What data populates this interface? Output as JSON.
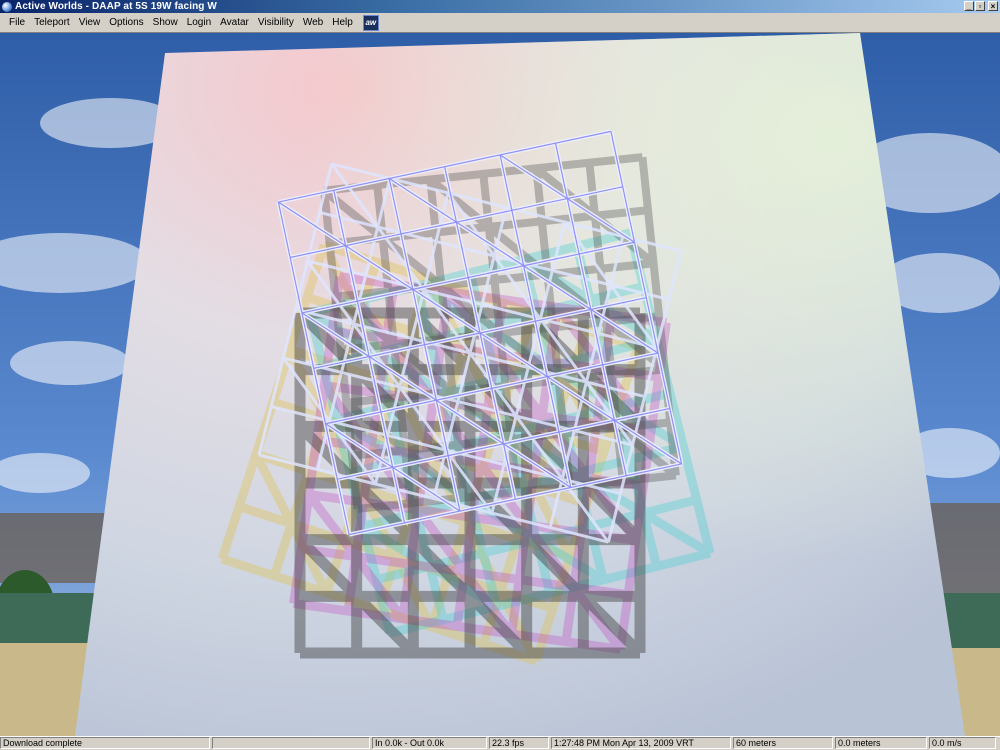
{
  "window": {
    "title": "Active Worlds - DAAP at 5S 19W facing W",
    "buttons": {
      "minimize": "_",
      "maximize": "▫",
      "close": "×"
    }
  },
  "menu": {
    "items": [
      "File",
      "Teleport",
      "View",
      "Options",
      "Show",
      "Login",
      "Avatar",
      "Visibility",
      "Web",
      "Help"
    ],
    "logo_text": "aw"
  },
  "scene": {
    "colors": {
      "sky": "#3f6fb8",
      "panel": "#d9d0dc",
      "grid": "#e8e8f4",
      "grid_edge": "#6a6ae8",
      "ground": "#3d6b57"
    }
  },
  "status": {
    "message": "Download complete",
    "traffic": "In  0.0k - Out  0.0k",
    "fps": "22.3 fps",
    "datetime": "1:27:48 PM Mon Apr 13, 2009 VRT",
    "visibility": "60 meters",
    "altitude": "0.0 meters",
    "speed": "0.0 m/s"
  }
}
